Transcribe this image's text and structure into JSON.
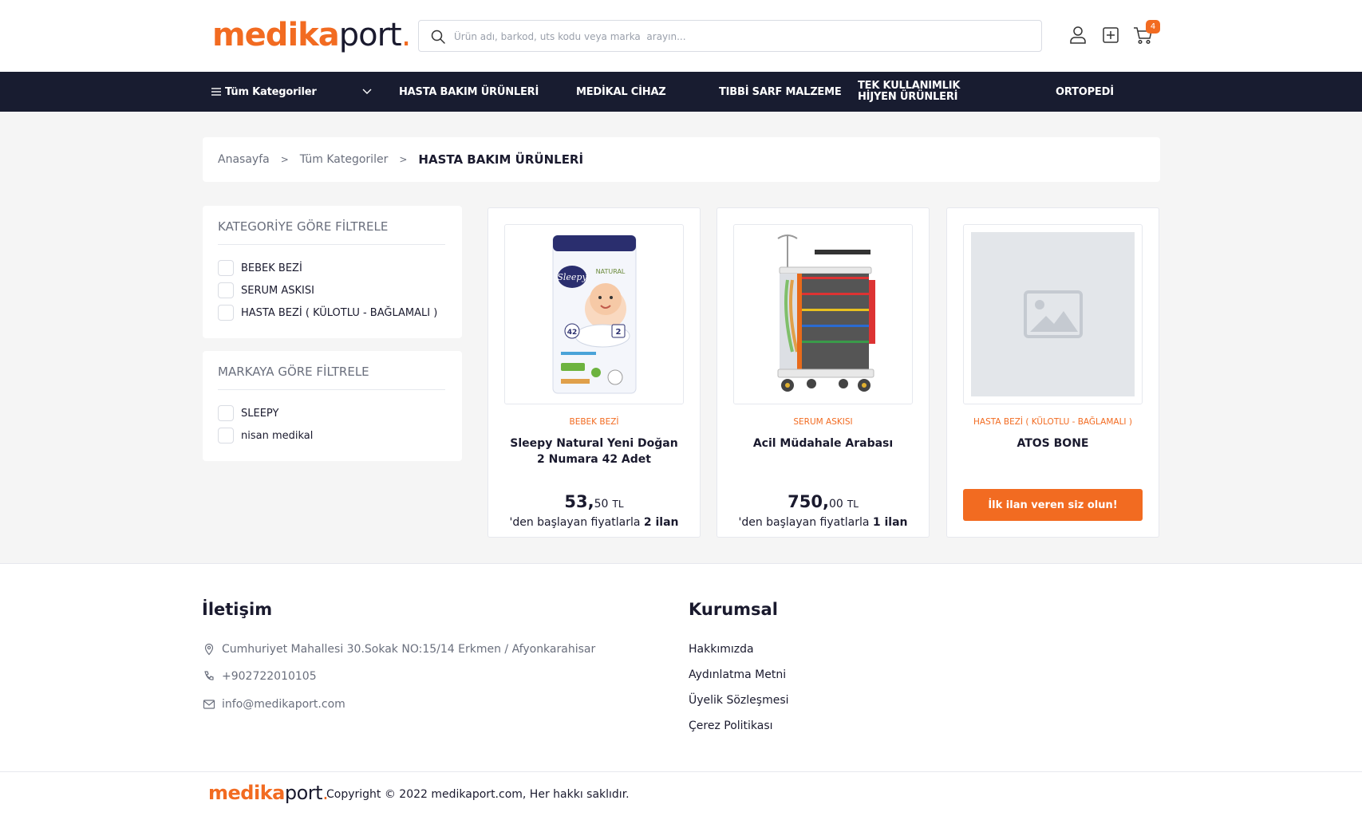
{
  "brand": {
    "part1": "medika",
    "part2": "port",
    "dot": ".",
    "accent": "#f26b21",
    "dark": "#181c30"
  },
  "search": {
    "placeholder": "Ürün adı, barkod, uts kodu veya marka  arayın..."
  },
  "header_icons": [
    "user-icon",
    "add-square-icon",
    "cart-icon"
  ],
  "cart": {
    "count": "4"
  },
  "nav": {
    "all_categories": "Tüm Kategoriler",
    "items": [
      "HASTA BAKIM ÜRÜNLERİ",
      "MEDİKAL CİHAZ",
      "TIBBİ SARF MALZEME",
      "TEK KULLANIMLIK HİJYEN ÜRÜNLERİ",
      "ORTOPEDİ"
    ]
  },
  "breadcrumb": {
    "items": [
      "Anasayfa",
      "Tüm Kategoriler"
    ],
    "current": "HASTA BAKIM ÜRÜNLERİ"
  },
  "filters": {
    "category": {
      "title": "KATEGORİYE GÖRE FİLTRELE",
      "options": [
        "BEBEK BEZİ",
        "SERUM ASKISI",
        "HASTA BEZİ ( KÜLOTLU - BAĞLAMALI )"
      ]
    },
    "brand": {
      "title": "MARKAYA GÖRE FİLTRELE",
      "options": [
        "SLEEPY",
        "nisan medikal"
      ]
    }
  },
  "products": [
    {
      "category": "BEBEK BEZİ",
      "title": "Sleepy Natural Yeni Doğan 2 Numara 42 Adet",
      "price_int": "53,",
      "price_dec": "50",
      "currency": "TL",
      "from_text": "'den başlayan fiyatlarla",
      "listing_count": "2 ilan"
    },
    {
      "category": "SERUM ASKISI",
      "title": "Acil Müdahale Arabası",
      "price_int": "750,",
      "price_dec": "00",
      "currency": "TL",
      "from_text": "'den başlayan fiyatlarla",
      "listing_count": "1 ilan"
    },
    {
      "category": "HASTA BEZİ ( KÜLOTLU - BAĞLAMALI )",
      "title": "ATOS BONE",
      "cta": "İlk ilan veren siz olun!"
    }
  ],
  "package_text": {
    "brand": "Sleepy",
    "line": "NATURAL",
    "size": "2",
    "count": "42"
  },
  "footer": {
    "contact": {
      "title": "İletişim",
      "address": "Cumhuriyet Mahallesi 30.Sokak NO:15/14 Erkmen / Afyonkarahisar",
      "phone": "+902722010105",
      "email": "info@medikaport.com"
    },
    "corporate": {
      "title": "Kurumsal",
      "links": [
        "Hakkımızda",
        "Aydınlatma Metni",
        "Üyelik Sözleşmesi",
        "Çerez Politikası"
      ]
    },
    "copyright": "Copyright © 2022 medikaport.com, Her hakkı saklıdır."
  }
}
